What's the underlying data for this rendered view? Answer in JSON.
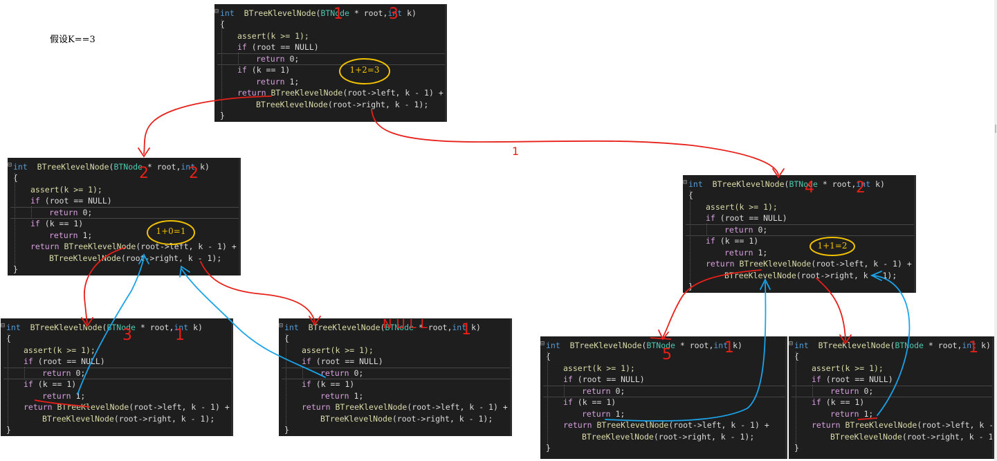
{
  "note": "假设K==3",
  "panels": [
    {
      "id": "p1",
      "name": "code-panel-root",
      "params": [
        "1",
        "3"
      ],
      "result": "1+2=3"
    },
    {
      "id": "p2",
      "name": "code-panel-left-child",
      "params": [
        "2",
        "2"
      ],
      "result": "1+0=1"
    },
    {
      "id": "p3",
      "name": "code-panel-right-child",
      "params": [
        "4",
        "2"
      ],
      "result": "1+1=2"
    },
    {
      "id": "p4",
      "name": "code-panel-left-left-leaf",
      "params": [
        "3",
        "1"
      ],
      "result": ""
    },
    {
      "id": "p5",
      "name": "code-panel-left-right-null",
      "params": [
        "NULL",
        "1"
      ],
      "result": ""
    },
    {
      "id": "p6",
      "name": "code-panel-right-left-leaf",
      "params": [
        "5",
        "1"
      ],
      "result": ""
    },
    {
      "id": "p7",
      "name": "code-panel-right-right-leaf",
      "params": [
        "",
        "1"
      ],
      "result": ""
    }
  ],
  "code": {
    "signature_kw": "int",
    "signature_fn": "BTreeKlevelNode",
    "signature_type": "BTNode",
    "signature_rest": " * root,",
    "signature_int": "int",
    "signature_k": " k)",
    "open_brace": "{",
    "assert_line": "assert(k >= 1);",
    "if_null_kw": "if",
    "if_null_rest": " (root == NULL)",
    "return0_kw": "return",
    "return0_rest": " 0;",
    "if_k1_kw": "if",
    "if_k1_rest": " (k == 1)",
    "return1_kw": "return",
    "return1_rest": " 1;",
    "return_call_kw": "return",
    "return_call_fn": "BTreeKlevelNode",
    "return_call_rest": "(root->left, k - 1) +",
    "right_call_fn": "BTreeKlevelNode",
    "right_call_rest": "(root->right, k - 1);",
    "close_brace": "}"
  },
  "edge_label": "1",
  "colors": {
    "arrow_down": "#e8201a",
    "arrow_up": "#1aa3e8",
    "oval": "#f2c200",
    "panel_bg": "#1e1e1e"
  }
}
